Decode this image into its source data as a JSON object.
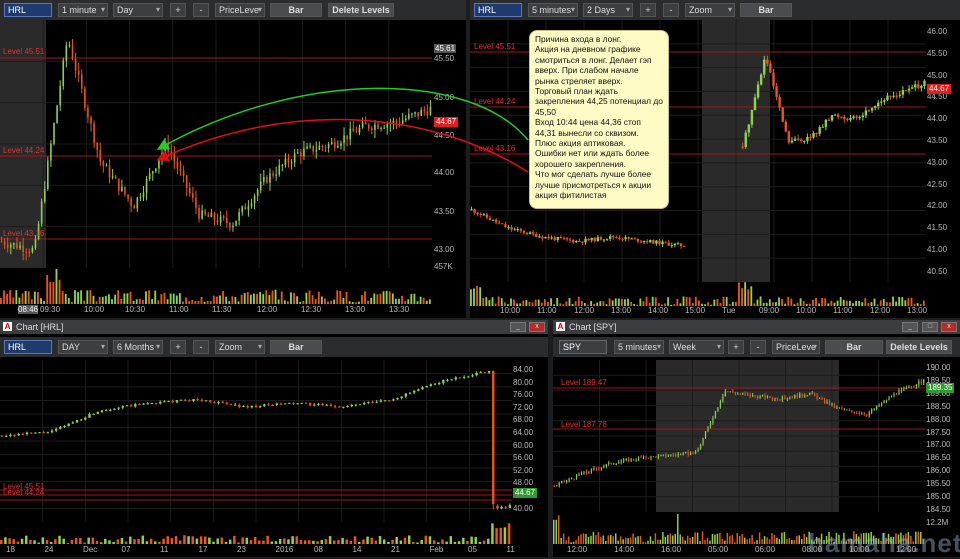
{
  "win1": {
    "toolbar": {
      "symbol": "HRL",
      "interval": "1 minute",
      "range": "Day",
      "plus": "+",
      "minus": "-",
      "tool": "PriceLeve",
      "bar": "Bar",
      "delete": "Delete Levels"
    },
    "levels": [
      "Level 45.51",
      "Level 44.24",
      "Level 43.16"
    ],
    "yticks": [
      "45.61",
      "45.50",
      "45.00",
      "44.50",
      "44.00",
      "43.50",
      "43.00",
      "457K"
    ],
    "price_tag": "44.67",
    "xticks": [
      "08:46",
      "09:30",
      "10:00",
      "10:30",
      "11:00",
      "11:30",
      "12:00",
      "12:30",
      "13:00",
      "13:30"
    ]
  },
  "win2": {
    "toolbar": {
      "symbol": "HRL",
      "interval": "5 minutes",
      "range": "2 Days",
      "plus": "+",
      "minus": "-",
      "tool": "Zoom",
      "bar": "Bar"
    },
    "levels": [
      "Level 45.51",
      "Level 44.24",
      "Level 43.16"
    ],
    "yticks": [
      "46.00",
      "45.50",
      "45.00",
      "44.50",
      "44.00",
      "43.50",
      "43.00",
      "42.50",
      "42.00",
      "41.50",
      "41.00",
      "40.50"
    ],
    "price_tag": "44.67",
    "xticks": [
      "10:00",
      "11:00",
      "12:00",
      "13:00",
      "14:00",
      "15:00",
      "Tue",
      "09:00",
      "10:00",
      "11:00",
      "12:00",
      "13:00"
    ]
  },
  "note": {
    "text": "Причина входа в лонг.\nАкция на дневном графике смотриться в лонг. Делает гэп вверх. При слабом начале рынка стреляет вверх.\nТорговый план ждать закрепления 44,25 потенциал до 45,50\nВход 10:44 цена 44,36 стоп 44,31 вынесли со сквизом.\nПлюс акция аптиковая.\nОшибки нет или ждать более хорошего закрепления.\nЧто мог сделать лучше более лучше присмотреться к акции акция фитилистая"
  },
  "win3": {
    "title": "Chart [HRL]",
    "toolbar": {
      "symbol": "HRL",
      "interval": "DAY",
      "range": "6 Months",
      "plus": "+",
      "minus": "-",
      "tool": "Zoom",
      "bar": "Bar"
    },
    "levels": [
      "Level 45.51",
      "Level 44.24"
    ],
    "yticks": [
      "84.00",
      "80.00",
      "76.00",
      "72.00",
      "68.00",
      "64.00",
      "60.00",
      "56.00",
      "52.00",
      "48.00",
      "44.00",
      "40.00"
    ],
    "price_tag": "44.67",
    "xticks": [
      "18",
      "24",
      "Dec",
      "07",
      "11",
      "17",
      "23",
      "2016",
      "08",
      "14",
      "21",
      "Feb",
      "05",
      "11"
    ]
  },
  "win4": {
    "title": "Chart [SPY]",
    "toolbar": {
      "symbol": "SPY",
      "interval": "5 minutes",
      "range": "Week",
      "plus": "+",
      "minus": "-",
      "tool": "PriceLeve",
      "bar": "Bar",
      "delete": "Delete Levels"
    },
    "levels": [
      "Level 189.47",
      "Level 187.78"
    ],
    "yticks": [
      "190.00",
      "189.50",
      "189.00",
      "188.50",
      "188.00",
      "187.50",
      "187.00",
      "186.50",
      "186.00",
      "185.50",
      "185.00",
      "184.50",
      "12.2M"
    ],
    "price_tag": "189.35",
    "xticks": [
      "12:00",
      "14:00",
      "16:00",
      "05:00",
      "06:00",
      "08:00",
      "10:00",
      "12:00"
    ]
  },
  "window_buttons": {
    "minimize": "_",
    "maximize": "□",
    "close": "x"
  },
  "watermark": "hamaha.net",
  "colors": {
    "up": "#8fd14f",
    "down": "#e8551f",
    "level": "#a01818",
    "arrow_green": "#22cc22",
    "arrow_red": "#dd1111",
    "session": "#2a2a2a"
  }
}
